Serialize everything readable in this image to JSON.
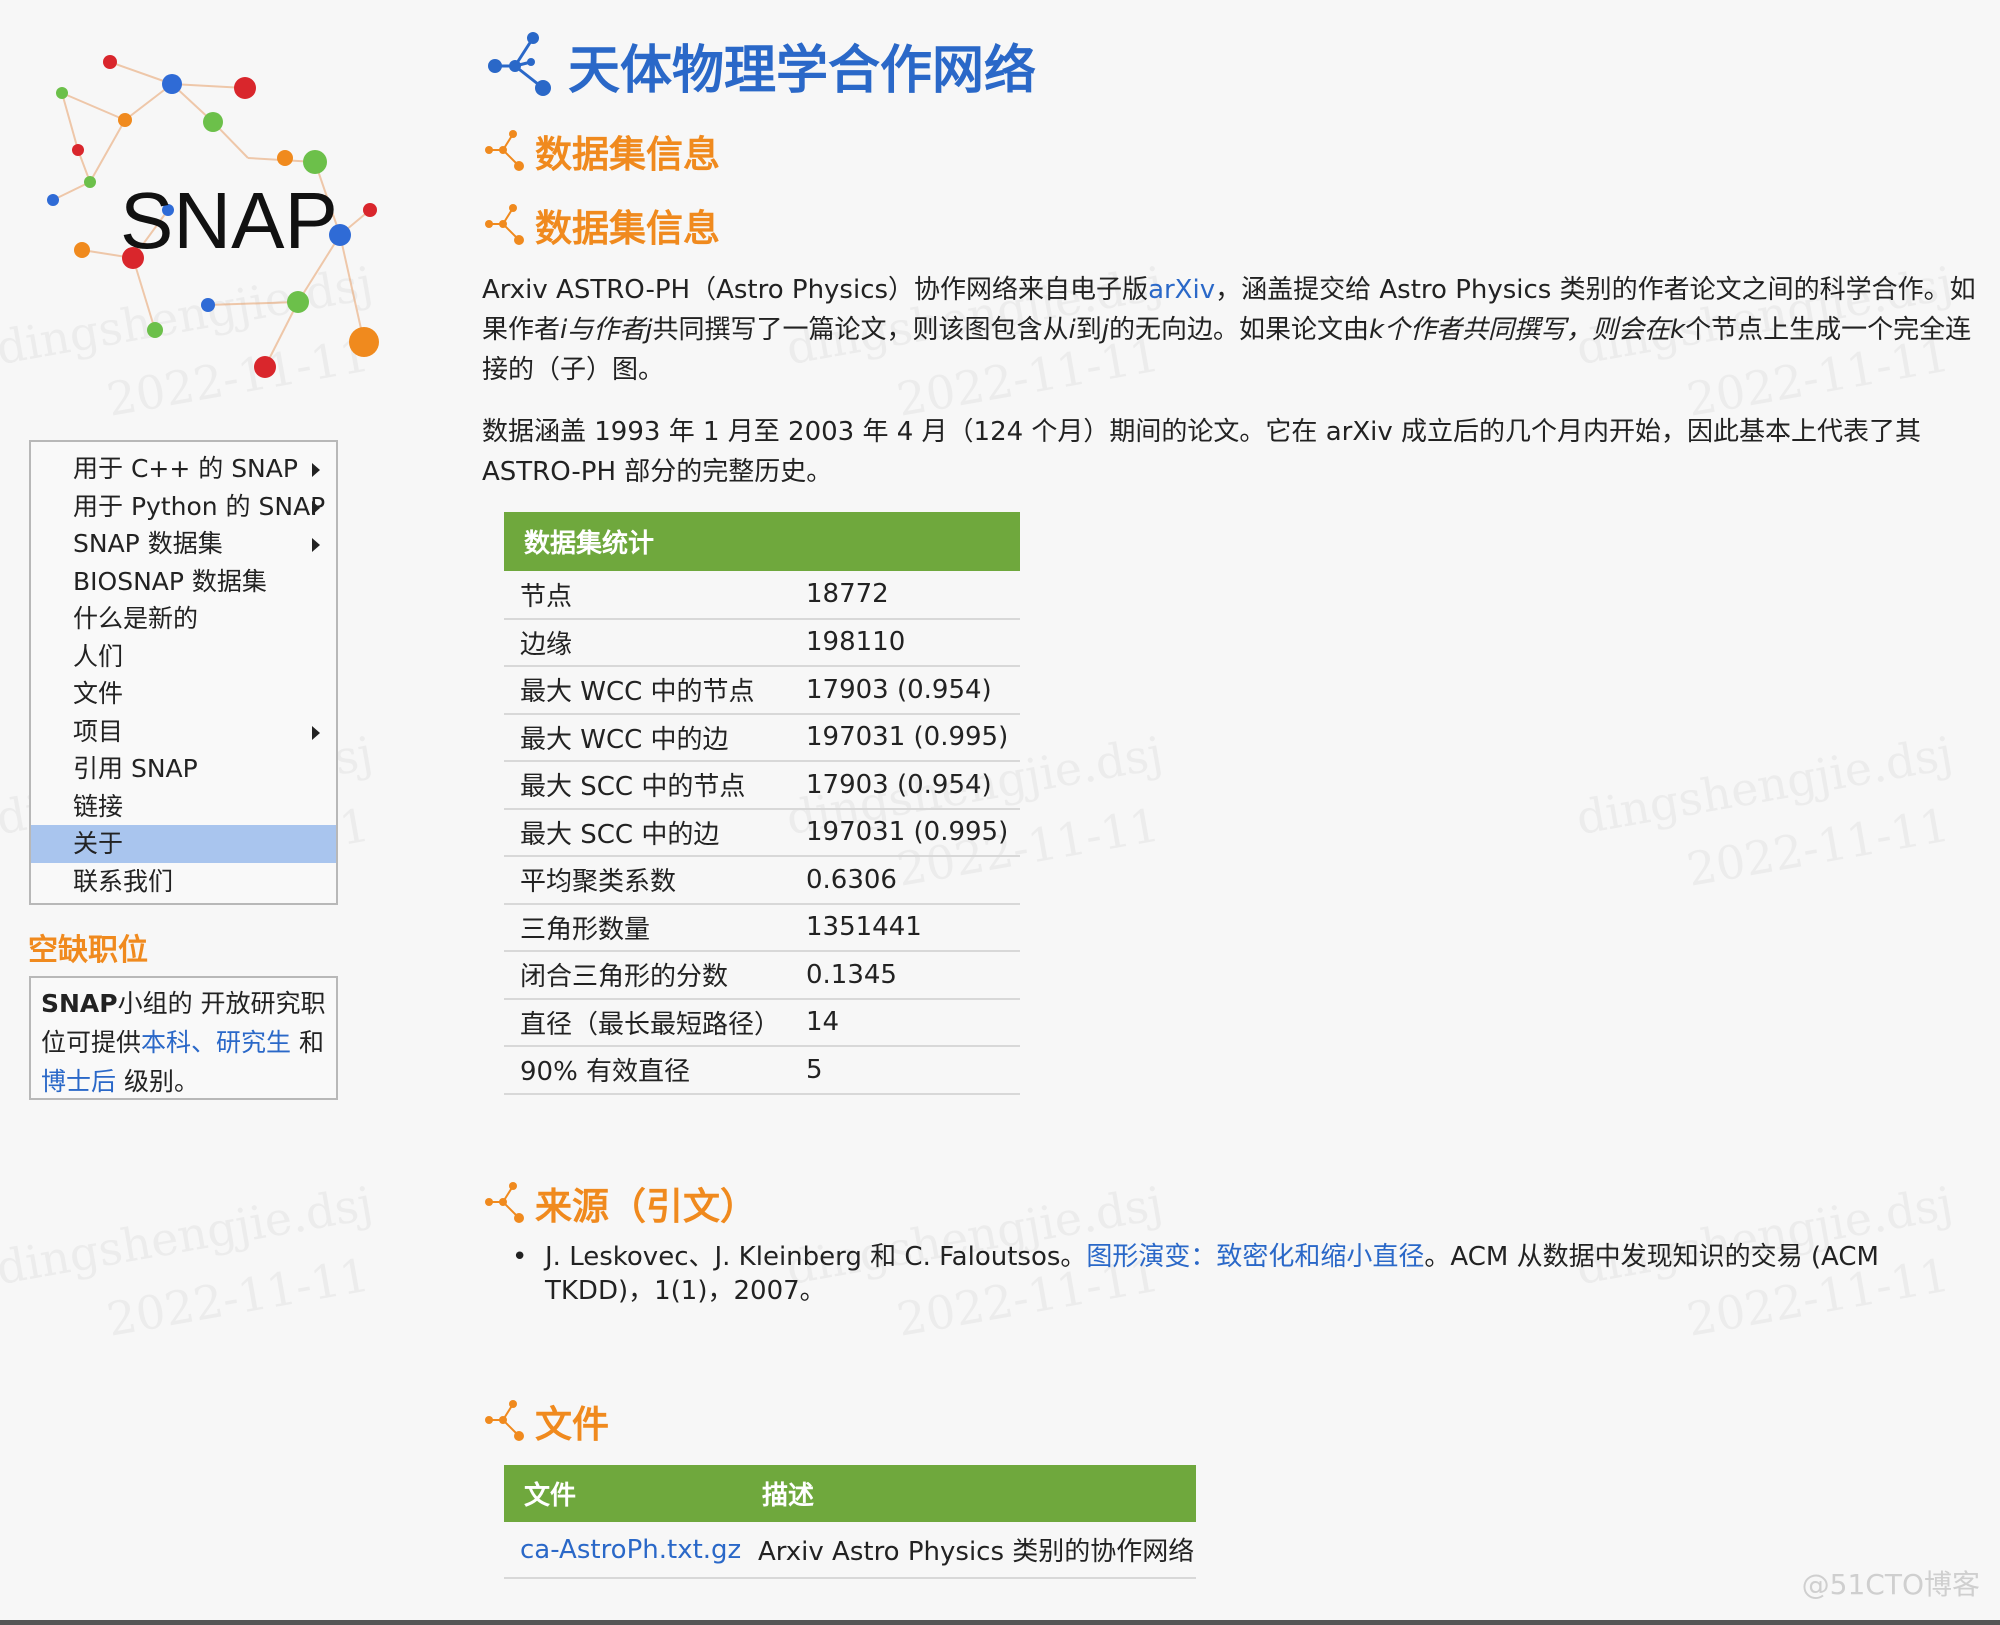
{
  "logo": {
    "text": "SNAP"
  },
  "menu": {
    "items": [
      {
        "label": "用于 C++ 的 SNAP",
        "has_submenu": true
      },
      {
        "label": "用于 Python 的 SNAP",
        "has_submenu": true
      },
      {
        "label": "SNAP 数据集",
        "has_submenu": true
      },
      {
        "label": "BIOSNAP 数据集",
        "has_submenu": false
      },
      {
        "label": "什么是新的",
        "has_submenu": false
      },
      {
        "label": "人们",
        "has_submenu": false
      },
      {
        "label": "文件",
        "has_submenu": false
      },
      {
        "label": "项目",
        "has_submenu": true
      },
      {
        "label": "引用 SNAP",
        "has_submenu": false
      },
      {
        "label": "链接",
        "has_submenu": false
      },
      {
        "label": "关于",
        "has_submenu": false,
        "active": true
      },
      {
        "label": "联系我们",
        "has_submenu": false
      }
    ]
  },
  "jobs": {
    "heading": "空缺职位",
    "text_bold": "SNAP",
    "text_1": "小组的 开放研究职位可提供",
    "link_1": "本科",
    "sep": "、",
    "link_2": "研究生",
    "text_2": " 和 ",
    "link_3": "博士后",
    "text_3": " 级别。"
  },
  "title": "天体物理学合作网络",
  "sections": {
    "info_1": "数据集信息",
    "info_2": "数据集信息",
    "source": "来源（引文）",
    "files": "文件"
  },
  "description": {
    "p1_a": "Arxiv ASTRO-PH（Astro Physics）协作网络来自电子版",
    "p1_link": "arXiv",
    "p1_b": "，涵盖提交给 Astro Physics 类别的作者论文之间的科学合作。如果作者",
    "p1_i1": "i与作者j",
    "p1_c": "共同撰写了一篇论文，则该图包含从",
    "p1_i2": "i",
    "p1_d": "到",
    "p1_i3": "j",
    "p1_e": "的无向边。如果论文由",
    "p1_i4": "k个作者共同撰写，则会在k",
    "p1_f": "个节点上生成一个完全连接的（子）图。",
    "p2": "数据涵盖 1993 年 1 月至 2003 年 4 月（124 个月）期间的论文。它在 arXiv 成立后的几个月内开始，因此基本上代表了其 ASTRO-PH 部分的完整历史。"
  },
  "stats": {
    "header": "数据集统计",
    "rows": [
      {
        "key": "节点",
        "value": "18772"
      },
      {
        "key": "边缘",
        "value": "198110"
      },
      {
        "key": "最大 WCC 中的节点",
        "value": "17903 (0.954)"
      },
      {
        "key": "最大 WCC 中的边",
        "value": "197031 (0.995)"
      },
      {
        "key": "最大 SCC 中的节点",
        "value": "17903 (0.954)"
      },
      {
        "key": "最大 SCC 中的边",
        "value": "197031 (0.995)"
      },
      {
        "key": "平均聚类系数",
        "value": "0.6306"
      },
      {
        "key": "三角形数量",
        "value": "1351441"
      },
      {
        "key": "闭合三角形的分数",
        "value": "0.1345"
      },
      {
        "key": "直径（最长最短路径）",
        "value": "14"
      },
      {
        "key": "90% 有效直径",
        "value": "5"
      }
    ]
  },
  "citation": {
    "bullet": "•",
    "authors": "J. Leskovec、J. Kleinberg 和 C. Faloutsos。",
    "link": "图形演变：致密化和缩小直径",
    "rest": "。ACM 从数据中发现知识的交易 (ACM TKDD)，1(1)，2007。"
  },
  "files": {
    "col_file": "文件",
    "col_desc": "描述",
    "rows": [
      {
        "file": "ca-AstroPh.txt.gz",
        "desc": "Arxiv Astro Physics 类别的协作网络"
      }
    ]
  },
  "watermark": {
    "line1": "dingshengjie.dsj",
    "line2": "2022-11-11"
  },
  "corner_mark": "@51CTO博客",
  "colors": {
    "accent_blue": "#2a68c8",
    "accent_orange": "#f08a1e",
    "table_green": "#6fa83d",
    "active_menu": "#a9c5ee"
  }
}
